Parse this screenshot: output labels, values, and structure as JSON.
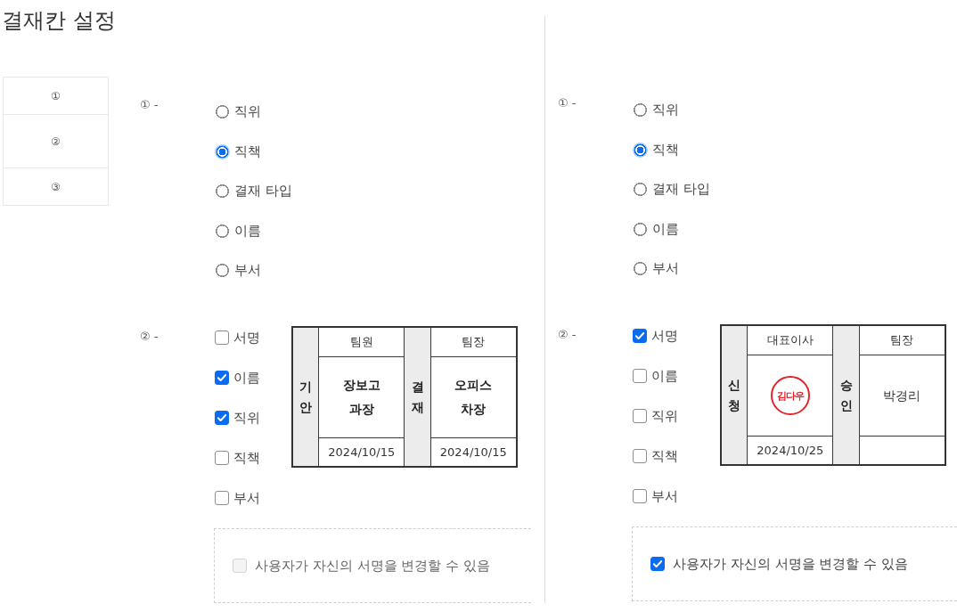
{
  "title": "결재칸 설정",
  "index_rows": [
    "①",
    "②",
    "③"
  ],
  "panels": [
    {
      "position_source": {
        "marker": "① -",
        "options": [
          {
            "label": "직위",
            "selected": false
          },
          {
            "label": "직책",
            "selected": true
          },
          {
            "label": "결재 타입",
            "selected": false
          },
          {
            "label": "이름",
            "selected": false
          },
          {
            "label": "부서",
            "selected": false
          }
        ]
      },
      "display_items": {
        "marker": "② -",
        "options": [
          {
            "label": "서명",
            "checked": false
          },
          {
            "label": "이름",
            "checked": true
          },
          {
            "label": "직위",
            "checked": true
          },
          {
            "label": "직책",
            "checked": false
          },
          {
            "label": "부서",
            "checked": false
          }
        ]
      },
      "preview": {
        "columns": [
          {
            "side_label": "기안",
            "header": "팀원",
            "body": {
              "kind": "name",
              "lines": [
                "장보고",
                "과장"
              ],
              "bold": true
            },
            "date": "2024/10/15"
          },
          {
            "side_label": "결재",
            "header": "팀장",
            "body": {
              "kind": "name",
              "lines": [
                "오피스",
                "차장"
              ],
              "bold": true
            },
            "date": "2024/10/15"
          }
        ]
      },
      "signature_change": {
        "label": "사용자가 자신의 서명을 변경할 수 있음",
        "checked": false,
        "disabled": true
      }
    },
    {
      "position_source": {
        "marker": "① -",
        "options": [
          {
            "label": "직위",
            "selected": false
          },
          {
            "label": "직책",
            "selected": true
          },
          {
            "label": "결재 타입",
            "selected": false
          },
          {
            "label": "이름",
            "selected": false
          },
          {
            "label": "부서",
            "selected": false
          }
        ]
      },
      "display_items": {
        "marker": "② -",
        "options": [
          {
            "label": "서명",
            "checked": true
          },
          {
            "label": "이름",
            "checked": false
          },
          {
            "label": "직위",
            "checked": false
          },
          {
            "label": "직책",
            "checked": false
          },
          {
            "label": "부서",
            "checked": false
          }
        ]
      },
      "preview": {
        "columns": [
          {
            "side_label": "신청",
            "header": "대표이사",
            "body": {
              "kind": "seal",
              "text": "김다우"
            },
            "date": "2024/10/25"
          },
          {
            "side_label": "승인",
            "header": "팀장",
            "body": {
              "kind": "name",
              "lines": [
                "박경리"
              ],
              "bold": false
            }
          }
        ]
      },
      "signature_change": {
        "label": "사용자가 자신의 서명을 변경할 수 있음",
        "checked": true,
        "disabled": false
      }
    }
  ]
}
